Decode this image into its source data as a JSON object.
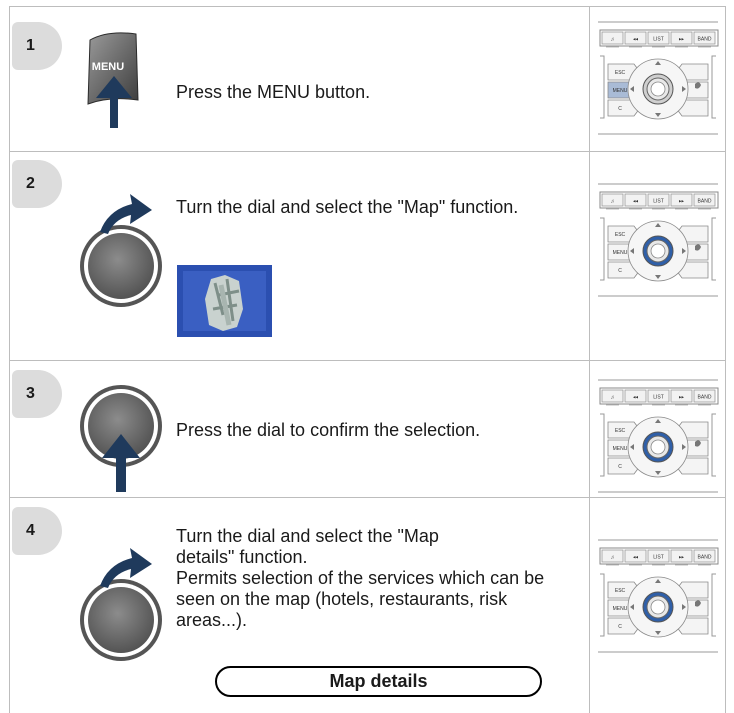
{
  "steps": [
    {
      "number": "1",
      "button_label": "MENU",
      "text": "Press the MENU button."
    },
    {
      "number": "2",
      "text": "Turn the dial and select the \"Map\" function."
    },
    {
      "number": "3",
      "text": "Press the dial to confirm the selection."
    },
    {
      "number": "4",
      "text_line1": "Turn the dial and select the \"Map details\" function.",
      "text_line2": "Permits selection of the services which can be seen on the map (hotels, restaurants, risk areas...).",
      "button_label": "Map details"
    }
  ],
  "panel": {
    "top_buttons": [
      "♫",
      "◂◂",
      "LIST",
      "▸▸",
      "BAND"
    ],
    "left_buttons": [
      "ESC",
      "MENU",
      "C"
    ]
  },
  "colors": {
    "grid": "#bdbdbd",
    "badge": "#dcdcdc",
    "arrow": "#1f3a5c",
    "dial_ring": "#4a4a4a"
  },
  "icons": [
    "menu-key-icon",
    "rotate-arrow-icon",
    "press-arrow-icon",
    "dial-icon",
    "map-function-icon",
    "control-panel-icon"
  ]
}
